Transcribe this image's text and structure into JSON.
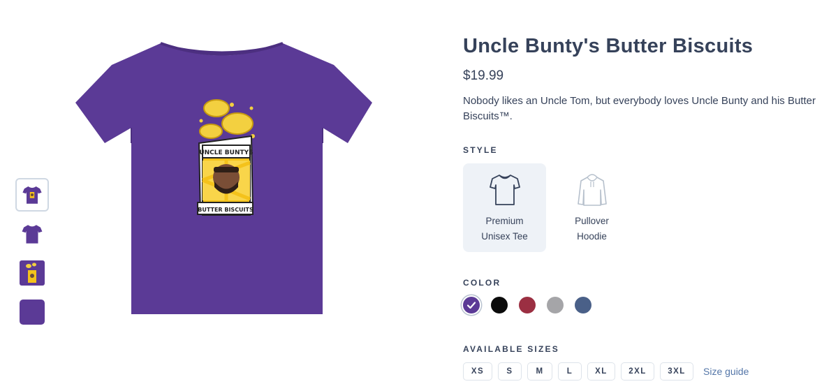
{
  "product": {
    "title": "Uncle Bunty's Butter Biscuits",
    "price": "$19.99",
    "description": "Nobody likes an Uncle Tom, but everybody loves Uncle Bunty and his Butter Biscuits™.",
    "graphic_text_top": "UNCLE BUNTYS",
    "graphic_text_bottom": "BUTTER BISCUITS"
  },
  "style": {
    "label": "STYLE",
    "options": [
      {
        "name": "Premium Unisex Tee",
        "icon": "tshirt-icon",
        "selected": true
      },
      {
        "name": "Pullover Hoodie",
        "icon": "hoodie-icon",
        "selected": false
      }
    ]
  },
  "color": {
    "label": "COLOR",
    "options": [
      {
        "hex": "#5b3a96",
        "selected": true
      },
      {
        "hex": "#0b0b0b",
        "selected": false
      },
      {
        "hex": "#9b2f42",
        "selected": false
      },
      {
        "hex": "#a5a5a8",
        "selected": false
      },
      {
        "hex": "#4a6088",
        "selected": false
      }
    ]
  },
  "sizes": {
    "label": "AVAILABLE SIZES",
    "options": [
      "XS",
      "S",
      "M",
      "L",
      "XL",
      "2XL",
      "3XL"
    ],
    "guide_label": "Size guide"
  },
  "colors": {
    "shirt": "#5b3a96",
    "shirt_dark": "#4c2f80",
    "box_yellow": "#f4c21b",
    "link": "#5476a8"
  }
}
